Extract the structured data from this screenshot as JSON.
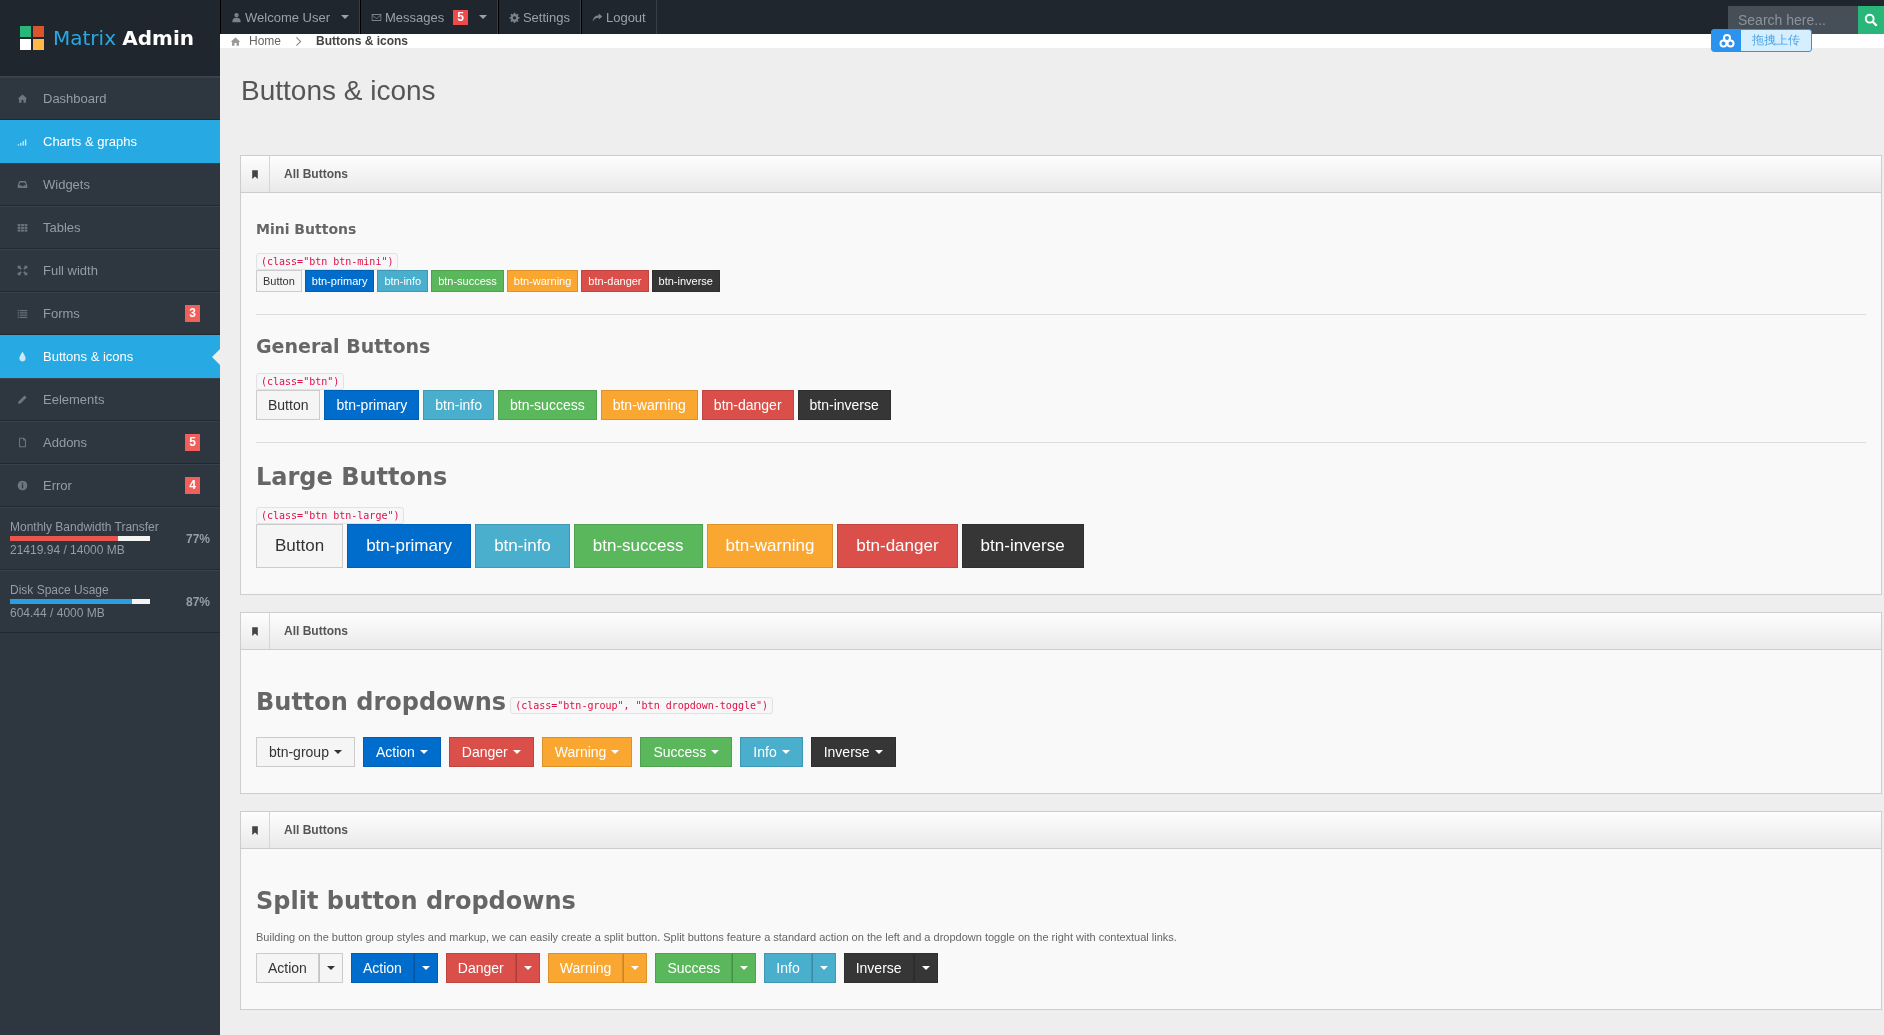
{
  "logo": {
    "first": "Matrix",
    "second": "Admin"
  },
  "topbar": {
    "items": [
      {
        "label": "Welcome User",
        "caret": true
      },
      {
        "label": "Messages",
        "caret": true,
        "badge": "5"
      },
      {
        "label": "Settings",
        "caret": false
      },
      {
        "label": "Logout",
        "caret": false
      }
    ],
    "search": {
      "placeholder": "Search here..."
    }
  },
  "upload_widget": {
    "label": "拖拽上传"
  },
  "sidebar": {
    "items": [
      {
        "label": "Dashboard",
        "selected": false,
        "current": false
      },
      {
        "label": "Charts & graphs",
        "selected": true,
        "current": false
      },
      {
        "label": "Widgets",
        "selected": false,
        "current": false
      },
      {
        "label": "Tables",
        "selected": false,
        "current": false
      },
      {
        "label": "Full width",
        "selected": false,
        "current": false
      },
      {
        "label": "Forms",
        "selected": false,
        "current": false,
        "badge": "3"
      },
      {
        "label": "Buttons & icons",
        "selected": true,
        "current": true
      },
      {
        "label": "Eelements",
        "selected": false,
        "current": false
      },
      {
        "label": "Addons",
        "selected": false,
        "current": false,
        "badge": "5"
      },
      {
        "label": "Error",
        "selected": false,
        "current": false,
        "badge": "4"
      }
    ],
    "stats": [
      {
        "label": "Monthly Bandwidth Transfer",
        "level": 0.77,
        "percent": "77%",
        "reading": "21419.94 / 14000 MB",
        "color": "#e9554f"
      },
      {
        "label": "Disk Space Usage",
        "level": 0.87,
        "percent": "87%",
        "reading": "604.44 / 4000 MB",
        "color": "#2a9ee0"
      }
    ]
  },
  "breadcrumb": [
    {
      "label": "Home"
    },
    {
      "label": "Buttons & icons"
    }
  ],
  "page_title": "Buttons & icons",
  "widgets": [
    {
      "title": "All Buttons",
      "groups": [
        {
          "heading": "Mini Buttons",
          "kind": "mini",
          "code": "(class=\"btn btn-mini\")",
          "buttons": [
            {
              "label": "Button",
              "kind": "default"
            },
            {
              "label": "btn-primary",
              "kind": "primary"
            },
            {
              "label": "btn-info",
              "kind": "info"
            },
            {
              "label": "btn-success",
              "kind": "success"
            },
            {
              "label": "btn-warning",
              "kind": "warning"
            },
            {
              "label": "btn-danger",
              "kind": "danger"
            },
            {
              "label": "btn-inverse",
              "kind": "inverse"
            }
          ]
        },
        {
          "heading": "General Buttons",
          "kind": "general",
          "code": "(class=\"btn\")",
          "buttons": [
            {
              "label": "Button",
              "kind": "default"
            },
            {
              "label": "btn-primary",
              "kind": "primary"
            },
            {
              "label": "btn-info",
              "kind": "info"
            },
            {
              "label": "btn-success",
              "kind": "success"
            },
            {
              "label": "btn-warning",
              "kind": "warning"
            },
            {
              "label": "btn-danger",
              "kind": "danger"
            },
            {
              "label": "btn-inverse",
              "kind": "inverse"
            }
          ]
        },
        {
          "heading": "Large Buttons",
          "kind": "large",
          "code": "(class=\"btn btn-large\")",
          "buttons": [
            {
              "label": "Button",
              "kind": "default"
            },
            {
              "label": "btn-primary",
              "kind": "primary"
            },
            {
              "label": "btn-info",
              "kind": "info"
            },
            {
              "label": "btn-success",
              "kind": "success"
            },
            {
              "label": "btn-warning",
              "kind": "warning"
            },
            {
              "label": "btn-danger",
              "kind": "danger"
            },
            {
              "label": "btn-inverse",
              "kind": "inverse"
            }
          ]
        }
      ]
    },
    {
      "title": "All Buttons",
      "groups": [
        {
          "heading": "Button dropdowns",
          "kind": "dropdown",
          "code": "(class=\"btn-group\", \"btn dropdown-toggle\")",
          "buttons": [
            {
              "label": "btn-group",
              "kind": "default"
            },
            {
              "label": "Action",
              "kind": "primary"
            },
            {
              "label": "Danger",
              "kind": "danger"
            },
            {
              "label": "Warning",
              "kind": "warning"
            },
            {
              "label": "Success",
              "kind": "success"
            },
            {
              "label": "Info",
              "kind": "info"
            },
            {
              "label": "Inverse",
              "kind": "inverse"
            }
          ]
        }
      ]
    },
    {
      "title": "All Buttons",
      "groups": [
        {
          "heading": "Split button dropdowns",
          "kind": "split",
          "description": "Building on the button group styles and markup, we can easily create a split button. Split buttons feature a standard action on the left and a dropdown toggle on the right with contextual links.",
          "buttons": [
            {
              "label": "Action",
              "kind": "default"
            },
            {
              "label": "Action",
              "kind": "primary"
            },
            {
              "label": "Danger",
              "kind": "danger"
            },
            {
              "label": "Warning",
              "kind": "warning"
            },
            {
              "label": "Success",
              "kind": "success"
            },
            {
              "label": "Info",
              "kind": "info"
            },
            {
              "label": "Inverse",
              "kind": "inverse"
            }
          ]
        }
      ]
    }
  ]
}
